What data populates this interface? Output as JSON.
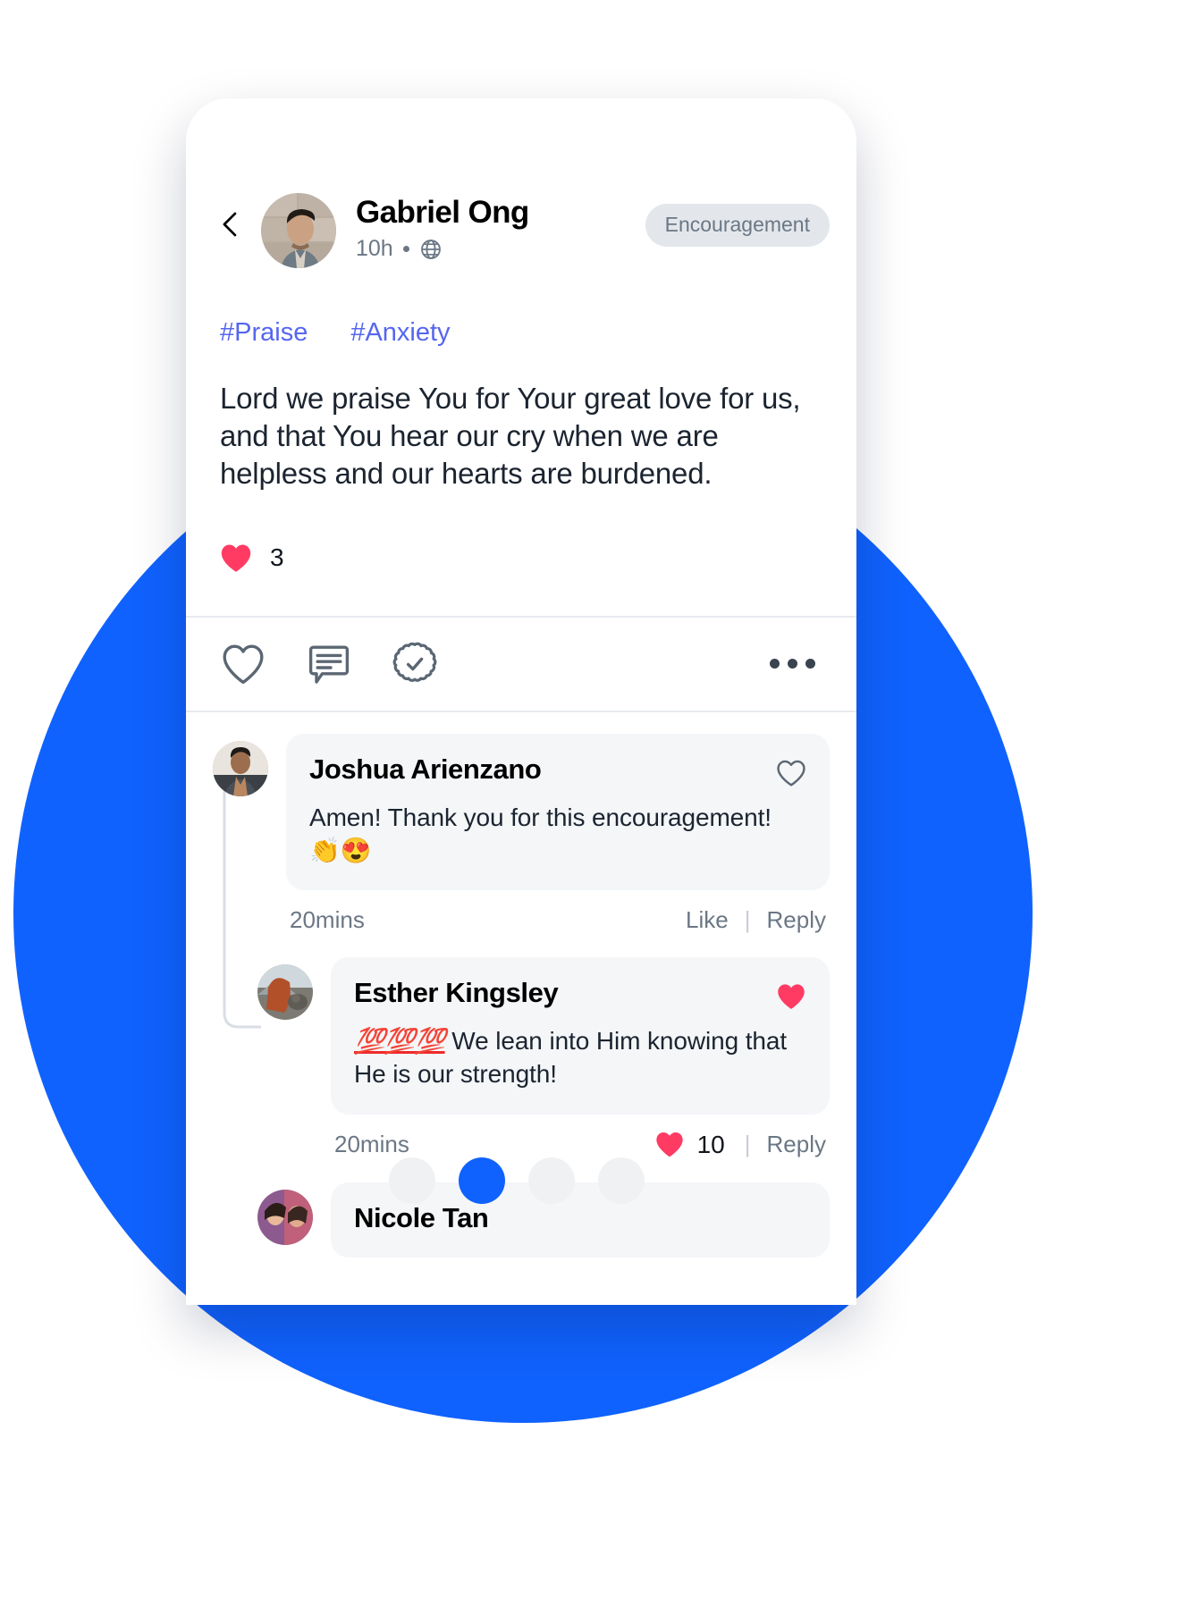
{
  "post": {
    "back_icon": "chevron-left-icon",
    "author": "Gabriel Ong",
    "time": "10h",
    "visibility_icon": "globe-icon",
    "badge": "Encouragement",
    "hashtags": [
      "#Praise",
      "#Anxiety"
    ],
    "body": "Lord we praise You for Your great love for us, and that You hear our cry when we are helpless and our hearts are burdened.",
    "reaction_icon": "heart-filled-icon",
    "reaction_count": "3",
    "actions": [
      {
        "name": "like-icon",
        "label": "Like"
      },
      {
        "name": "comment-icon",
        "label": "Comment"
      },
      {
        "name": "prayed-badge-icon",
        "label": "Prayed"
      }
    ],
    "more_icon": "more-horizontal-icon"
  },
  "comments": [
    {
      "author": "Joshua Arienzano",
      "text": "Amen! Thank you for this encouragement! 👏😍",
      "time": "20mins",
      "like_label": "Like",
      "reply_label": "Reply",
      "liked": false,
      "like_icon": "heart-outline-icon",
      "heart_count": ""
    },
    {
      "author": "Esther Kingsley",
      "text_prefix": "💯💯💯",
      "text": " We lean into Him knowing that He is our strength!",
      "time": "20mins",
      "reply_label": "Reply",
      "liked": true,
      "like_icon": "heart-filled-icon",
      "heart_count": "10"
    },
    {
      "author": "Nicole Tan"
    }
  ],
  "pagination": {
    "dots": [
      "inactive",
      "active",
      "inactive",
      "inactive"
    ],
    "active_index": 1,
    "active_color": "#1062FE",
    "inactive_color": "#F0F1F3"
  },
  "theme": {
    "background_circle": "#1062FE",
    "hashtag_color": "#5566F0",
    "heart_color": "#FF3B63",
    "badge_bg": "#E3E7EB",
    "badge_text": "#6B7785",
    "bubble_bg": "#F4F6F8"
  }
}
